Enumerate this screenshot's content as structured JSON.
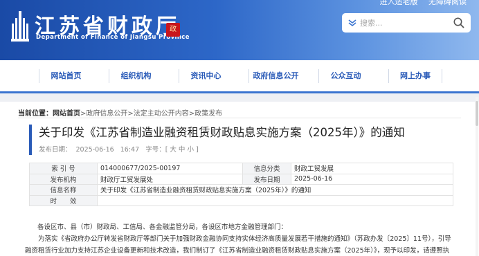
{
  "header": {
    "top_links": [
      "进入适老版",
      "无障碍阅读"
    ],
    "title": "江苏省财政厅",
    "subtitle": "Department of Finance of Jiangsu Province",
    "seal_text": "政",
    "search_placeholder": "搜索...",
    "colors": {
      "brand_blue": "#2a5bb8",
      "seal_red": "#c8161d"
    }
  },
  "nav": {
    "items": [
      "网站首页",
      "组织机构",
      "资讯中心",
      "政府信息公开",
      "公众互动",
      "网上办事"
    ]
  },
  "breadcrumb": {
    "label": "当前位置：",
    "home": "网站首页",
    "path": ">政府信息公开>法定主动公开内容>政策发布"
  },
  "article": {
    "title": "关于印发《江苏省制造业融资租赁财政贴息实施方案（2025年）》的通知",
    "publish_label": "发布日期：",
    "publish_date": "2025-06-16",
    "publish_time": "16:47",
    "font_size_label": "字号：[ 大 中 小 ]"
  },
  "info": {
    "index_label": "索 引 号",
    "index_value": "014000677/2025-00197",
    "category_label": "信息分类",
    "category_value": "财政工贸发展",
    "org_label": "发布机构",
    "org_value": "财政厅工贸发展处",
    "date_label": "发布日期",
    "date_value": "2025-06-16",
    "name_label": "信息名称",
    "name_value": "关于印发《江苏省制造业融资租赁财政贴息实施方案（2025年）》的通知",
    "validity_label": "时　　效",
    "validity_value": ""
  },
  "body": {
    "lines": [
      "各设区市、县（市）财政局、工信局、各金融监管分局，各设区市地方金融管理部门：",
      "　　为落实《省政府办公厅转发省财政厅等部门关于加强财政金融协同支持实体经济高质量发展若干措施的通知》（苏政办发〔2025〕11号），引导",
      "融资租赁行业加力支持江苏企业设备更新和技术改造，我们制订了《江苏省制造业融资租赁财政贴息实施方案（2025年）》，现予以印发，请遵照执"
    ]
  }
}
